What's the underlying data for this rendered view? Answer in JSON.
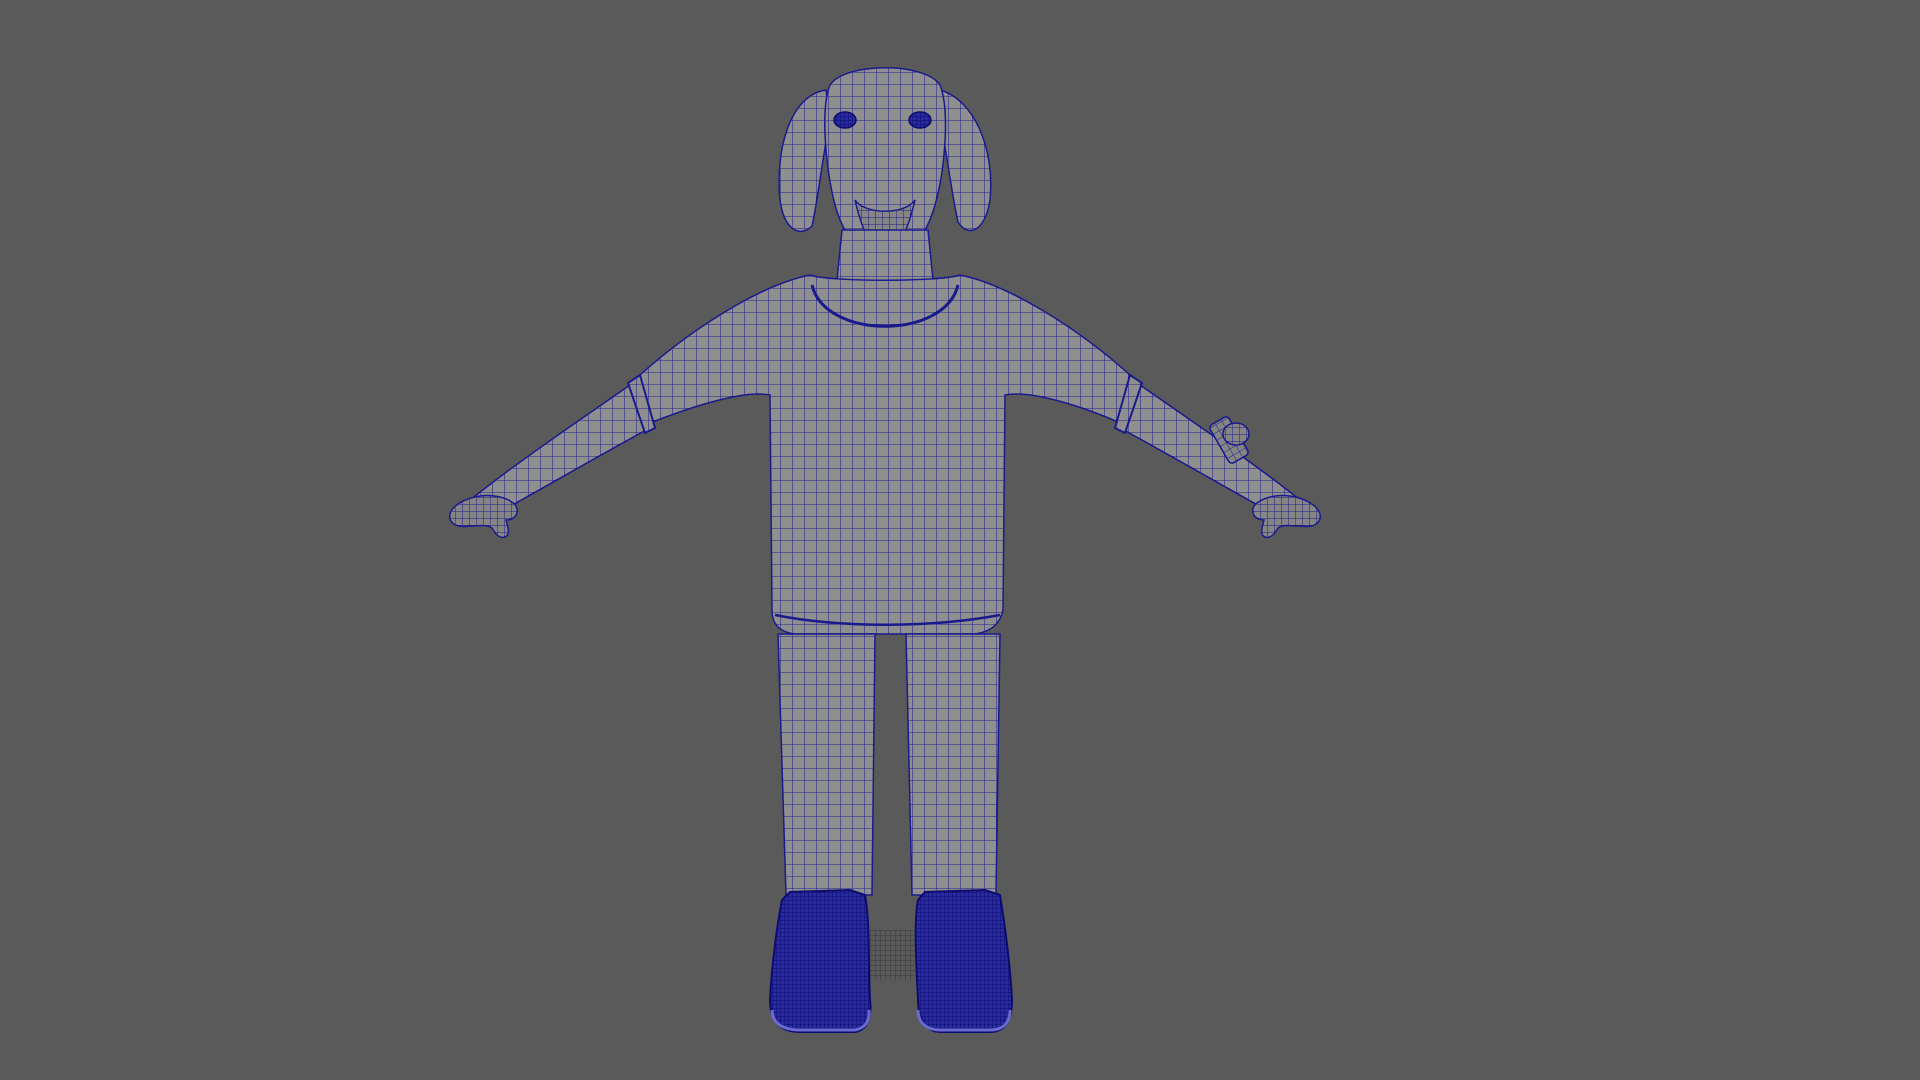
{
  "viewport": {
    "background": "#5a5a5a",
    "mode": "wireframe-on-shaded",
    "wire_color": "#1a1a8c",
    "surface_color": "#8c8c8c"
  },
  "scene": {
    "object": "dog-character-model",
    "pose": "t-pose",
    "parts": [
      "head",
      "left-ear",
      "right-ear",
      "neck",
      "shirt-torso",
      "left-sleeve",
      "right-sleeve",
      "left-arm",
      "right-arm",
      "left-hand",
      "right-hand",
      "wristwatch",
      "left-pant-leg",
      "right-pant-leg",
      "left-sneaker",
      "right-sneaker",
      "ground-grid"
    ]
  }
}
